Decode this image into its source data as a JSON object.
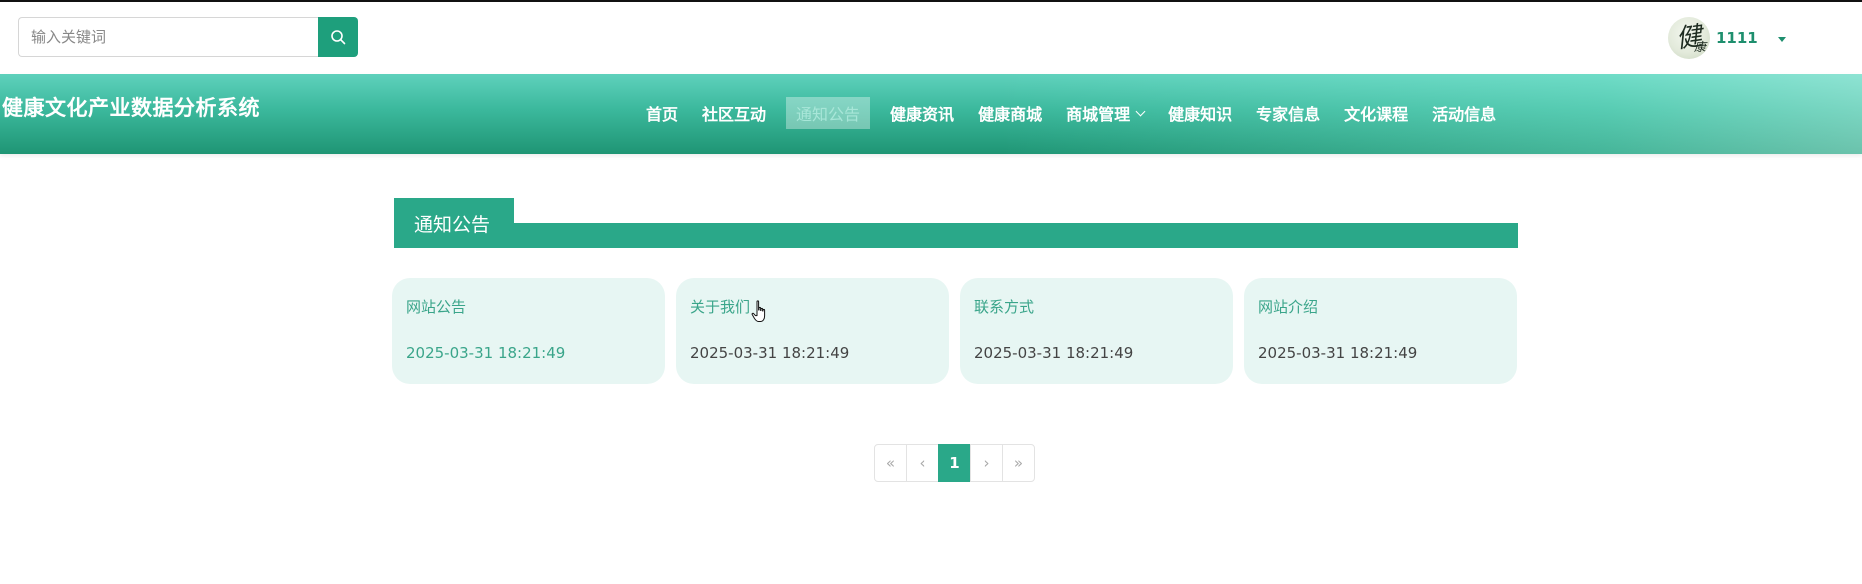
{
  "search": {
    "placeholder": "输入关键词",
    "icon": "search-icon"
  },
  "user": {
    "name": "1111",
    "avatar_text": "健",
    "avatar_text_small": "康"
  },
  "header": {
    "site_title": "健康文化产业数据分析系统"
  },
  "nav": {
    "items": [
      {
        "label": "首页"
      },
      {
        "label": "社区互动"
      },
      {
        "label": "通知公告",
        "active": true
      },
      {
        "label": "健康资讯"
      },
      {
        "label": "健康商城"
      },
      {
        "label": "商城管理",
        "has_dropdown": true
      },
      {
        "label": "健康知识"
      },
      {
        "label": "专家信息"
      },
      {
        "label": "文化课程"
      },
      {
        "label": "活动信息"
      }
    ]
  },
  "section": {
    "title": "通知公告"
  },
  "cards": [
    {
      "title": "网站公告",
      "date": "2025-03-31 18:21:49"
    },
    {
      "title": "关于我们",
      "date": "2025-03-31 18:21:49"
    },
    {
      "title": "联系方式",
      "date": "2025-03-31 18:21:49"
    },
    {
      "title": "网站介绍",
      "date": "2025-03-31 18:21:49"
    }
  ],
  "pagination": {
    "first": "«",
    "prev": "‹",
    "current": "1",
    "next": "›",
    "last": "»"
  },
  "colors": {
    "accent": "#2aa889",
    "card_bg": "#e7f6f3",
    "card_title": "#3aa58a"
  }
}
